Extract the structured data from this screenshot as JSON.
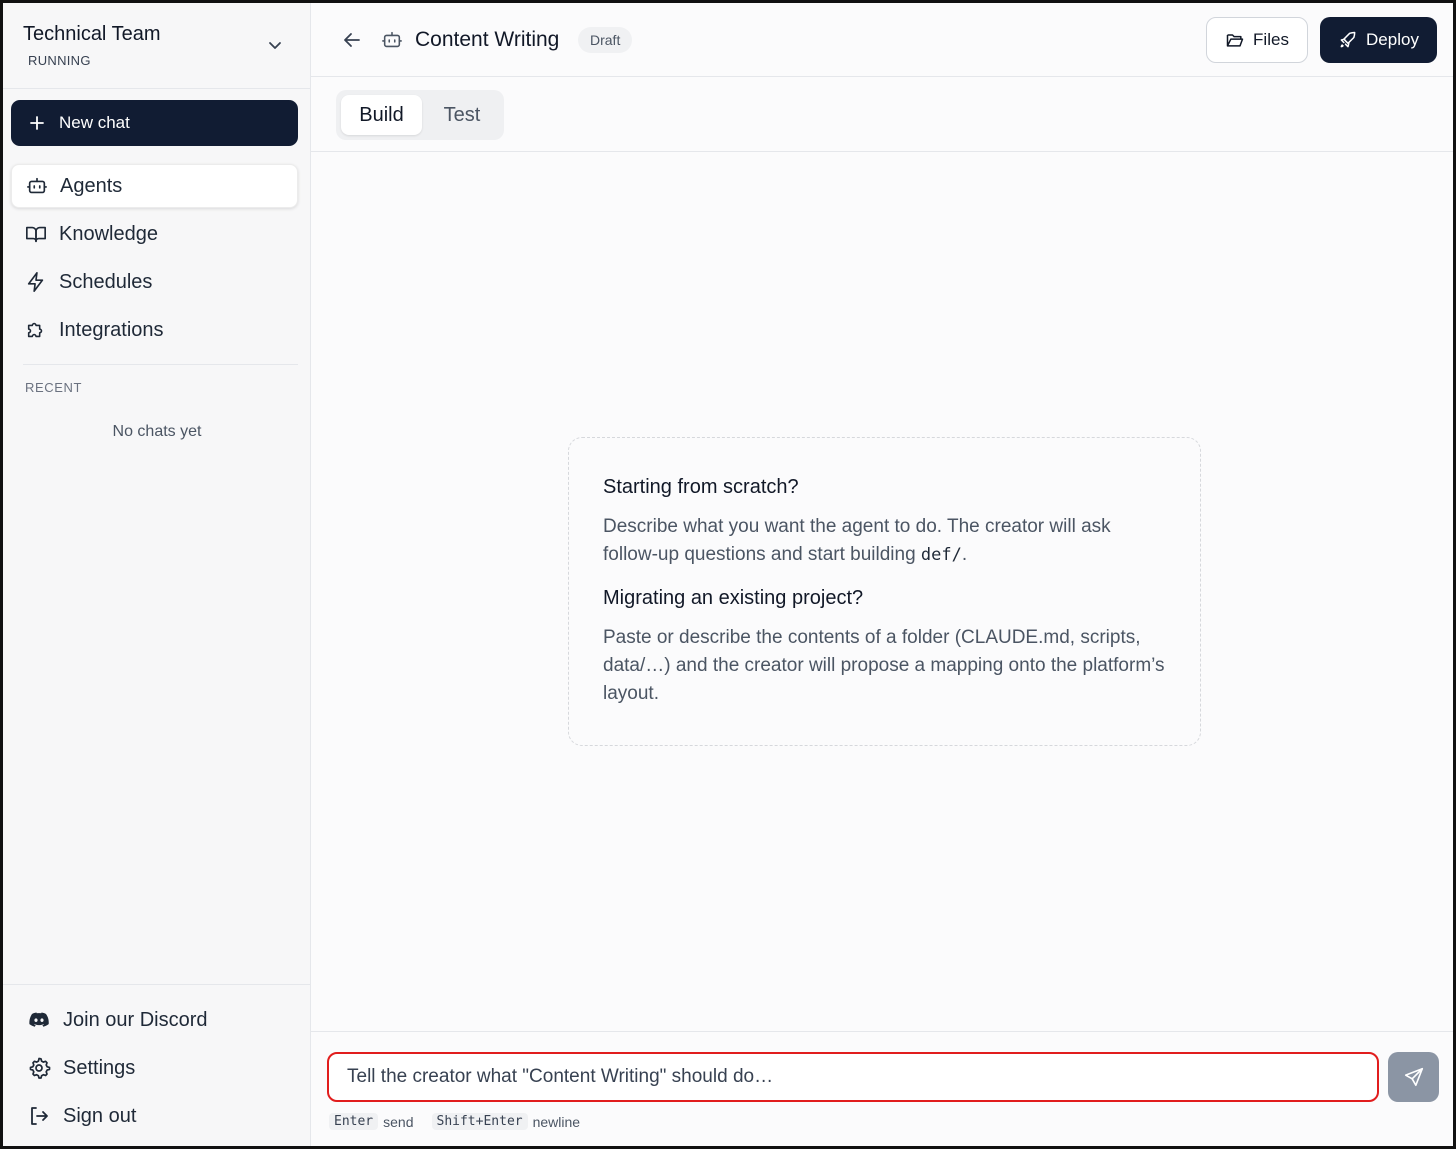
{
  "sidebar": {
    "workspace_name": "Technical Team",
    "workspace_status": "RUNNING",
    "new_chat_label": "New chat",
    "nav": {
      "agents": "Agents",
      "knowledge": "Knowledge",
      "schedules": "Schedules",
      "integrations": "Integrations"
    },
    "recent_label": "RECENT",
    "no_chats": "No chats yet",
    "bottom": {
      "discord": "Join our Discord",
      "settings": "Settings",
      "sign_out": "Sign out"
    }
  },
  "header": {
    "title": "Content Writing",
    "badge": "Draft",
    "files_label": "Files",
    "deploy_label": "Deploy"
  },
  "tabs": {
    "build": "Build",
    "test": "Test"
  },
  "card": {
    "scratch_title": "Starting from scratch?",
    "scratch_text_pre": "Describe what you want the agent to do. The creator will ask follow-up questions and start building ",
    "scratch_code": "def/",
    "scratch_text_post": ".",
    "migrate_title": "Migrating an existing project?",
    "migrate_text": "Paste or describe the contents of a folder (CLAUDE.md, scripts, data/…) and the creator will propose a mapping onto the platform’s layout."
  },
  "composer": {
    "placeholder": "Tell the creator what \"Content Writing\" should do…",
    "value": "",
    "hint_enter_key": "Enter",
    "hint_enter_text": "send",
    "hint_shift_key": "Shift+Enter",
    "hint_shift_text": "newline"
  },
  "colors": {
    "primary_dark": "#111c33",
    "input_focus_border": "#e11d1d",
    "send_button": "#8b95a4"
  }
}
